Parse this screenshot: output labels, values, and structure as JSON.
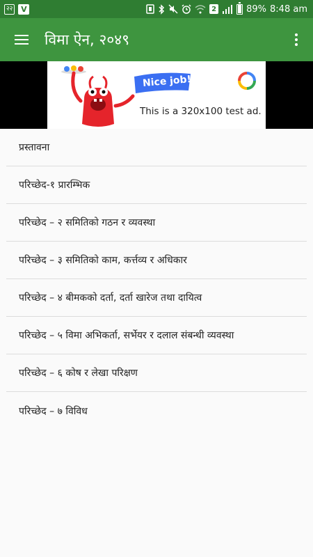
{
  "status_bar": {
    "left_icon_1": "२२",
    "left_icon_2": "V",
    "sim_badge": "2",
    "battery": "89%",
    "time": "8:48 am"
  },
  "toolbar": {
    "title": "विमा ऐन, २०४९",
    "menu_icon": "hamburger-icon",
    "overflow_icon": "more-vert-icon"
  },
  "ad": {
    "flag_text": "Nice job!",
    "text": "This is a 320x100 test ad.",
    "colors": {
      "flag": "#3b6ff2",
      "monster": "#e5242b"
    }
  },
  "chapters": [
    {
      "label": "प्रस्तावना"
    },
    {
      "label": "परिच्छेद-१ प्रारम्भिक"
    },
    {
      "label": "परिच्छेद – २ समितिको गठन र व्यवस्था"
    },
    {
      "label": "परिच्छेद – ३ समितिको काम, कर्त्तव्य र अधिकार"
    },
    {
      "label": "परिच्छेद – ४ बीमकको दर्ता, दर्ता खारेज तथा दायित्व"
    },
    {
      "label": "परिच्छेद – ५ विमा अभिकर्ता, सर्भेयर र दलाल संबन्धी व्यवस्था"
    },
    {
      "label": "परिच्छेद – ६ कोष र लेखा परिक्षण"
    },
    {
      "label": "परिच्छेद – ७   विविध"
    }
  ],
  "colors": {
    "status_bar": "#2f7d32",
    "toolbar": "#3e953f"
  }
}
